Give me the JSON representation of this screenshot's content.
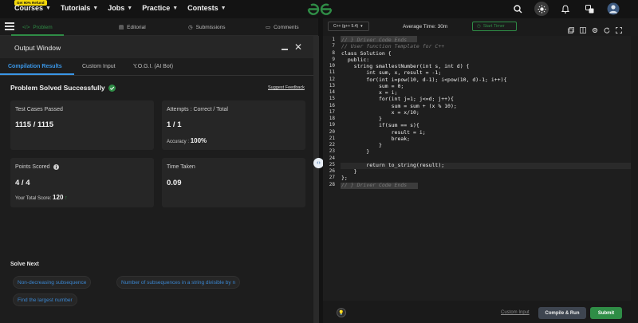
{
  "nav": {
    "badge": "Get 90% Refund",
    "items": [
      {
        "label": "Courses"
      },
      {
        "label": "Tutorials"
      },
      {
        "label": "Jobs"
      },
      {
        "label": "Practice"
      },
      {
        "label": "Contests"
      }
    ],
    "logo_color": "#2f8d46"
  },
  "problem_tabs": [
    {
      "label": "Problem",
      "icon": "code-icon",
      "active": true
    },
    {
      "label": "Editorial",
      "icon": "document-icon",
      "active": false
    },
    {
      "label": "Submissions",
      "icon": "clock-icon",
      "active": false
    },
    {
      "label": "Comments",
      "icon": "comment-icon",
      "active": false
    }
  ],
  "output": {
    "title": "Output Window",
    "tabs": [
      "Compilation Results",
      "Custom Input",
      "Y.O.G.I. (AI Bot)"
    ],
    "status": "Problem Solved Successfully",
    "feedback": "Suggest Feedback",
    "test_cases_label": "Test Cases Passed",
    "test_cases_value": "1115 / 1115",
    "attempts_label": "Attempts : Correct / Total",
    "attempts_value": "1 / 1",
    "accuracy_label": "Accuracy :",
    "accuracy_value": "100%",
    "points_label": "Points Scored",
    "points_value": "4 / 4",
    "total_score_label": "Your Total Score:",
    "total_score_value": "120",
    "time_label": "Time Taken",
    "time_value": "0.09",
    "solve_next_label": "Solve Next",
    "solve_next": [
      "Non-decreasing subsequence",
      "Number of subsequences in a string divisible by n",
      "Find the largest number"
    ]
  },
  "editor": {
    "language": "C++ (g++ 5.4)",
    "avg_time": "Average Time: 30m",
    "timer": "Start Timer",
    "lines": [
      {
        "n": "1",
        "t": "// } Driver Code Ends"
      },
      {
        "n": "7",
        "t": "// User function Template for C++"
      },
      {
        "n": "8",
        "t": "class Solution {"
      },
      {
        "n": "9",
        "t": "  public:"
      },
      {
        "n": "10",
        "t": "    string smallestNumber(int s, int d) {"
      },
      {
        "n": "11",
        "t": "        int sum, x, result = -1;"
      },
      {
        "n": "12",
        "t": "        for(int i=pow(10, d-1); i<pow(10, d)-1; i++){"
      },
      {
        "n": "13",
        "t": "            sum = 0;"
      },
      {
        "n": "14",
        "t": "            x = i;"
      },
      {
        "n": "15",
        "t": "            for(int j=1; j<=d; j++){"
      },
      {
        "n": "16",
        "t": "                sum = sum + (x % 10);"
      },
      {
        "n": "17",
        "t": "                x = x/10;"
      },
      {
        "n": "18",
        "t": "            }"
      },
      {
        "n": "19",
        "t": "            if(sum == s){"
      },
      {
        "n": "20",
        "t": "                result = i;"
      },
      {
        "n": "21",
        "t": "                break;"
      },
      {
        "n": "22",
        "t": "            }"
      },
      {
        "n": "23",
        "t": "        }"
      },
      {
        "n": "24",
        "t": ""
      },
      {
        "n": "25",
        "t": "        return to_string(result);"
      },
      {
        "n": "26",
        "t": "    }"
      },
      {
        "n": "27",
        "t": "};"
      },
      {
        "n": "28",
        "t": "// } Driver Code Ends"
      }
    ],
    "custom_input": "Custom Input",
    "compile": "Compile & Run",
    "submit": "Submit"
  }
}
